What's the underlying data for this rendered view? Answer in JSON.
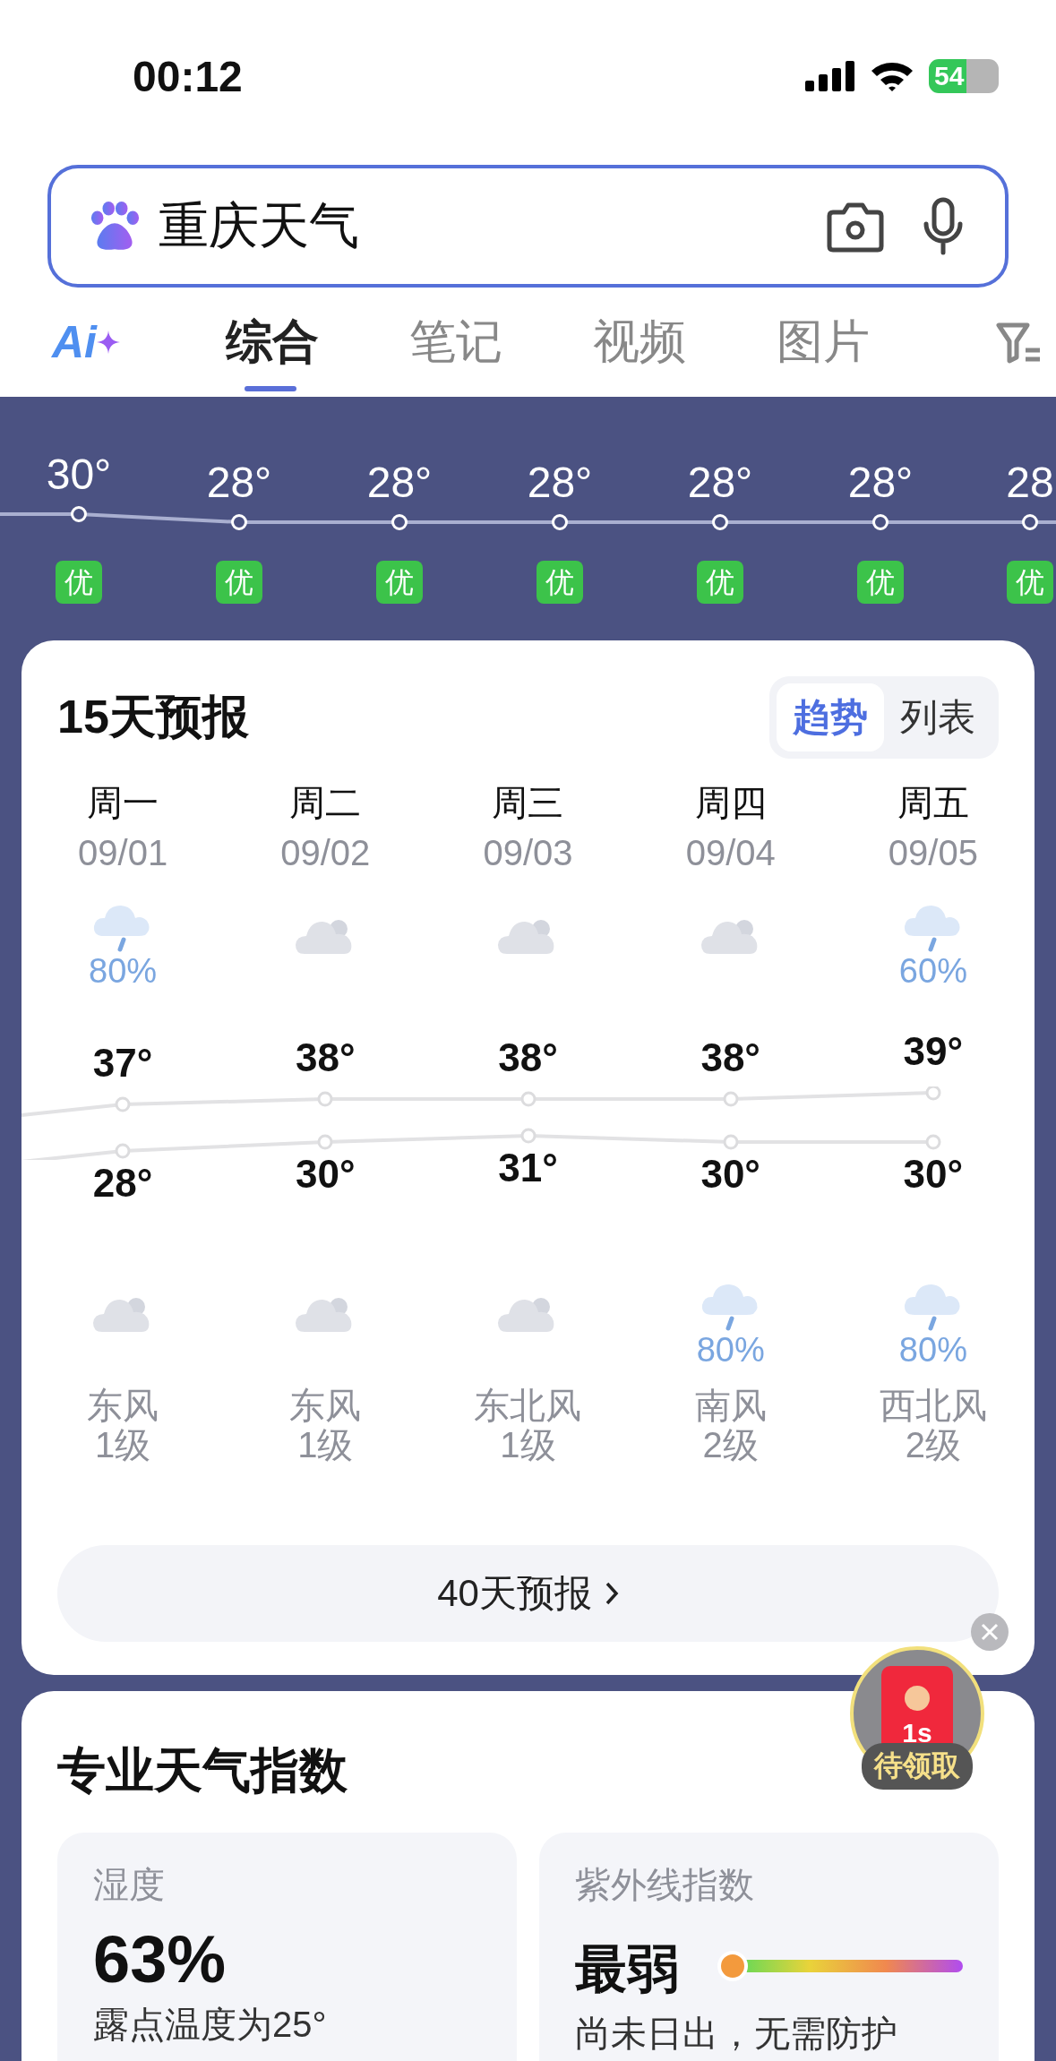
{
  "status_bar": {
    "time": "00:12",
    "battery": "54"
  },
  "search": {
    "value": "重庆天气"
  },
  "ai_label": "Ai",
  "tabs": [
    {
      "label": "综合",
      "selected": true
    },
    {
      "label": "笔记",
      "selected": false
    },
    {
      "label": "视频",
      "selected": false
    },
    {
      "label": "图片",
      "selected": false
    }
  ],
  "hourly": [
    {
      "temp": "30°",
      "aqi": "优",
      "color": "#3cc34a"
    },
    {
      "temp": "28°",
      "aqi": "优",
      "color": "#3cc34a"
    },
    {
      "temp": "28°",
      "aqi": "优",
      "color": "#3cc34a"
    },
    {
      "temp": "28°",
      "aqi": "优",
      "color": "#3cc34a"
    },
    {
      "temp": "28°",
      "aqi": "优",
      "color": "#3cc34a"
    },
    {
      "temp": "28°",
      "aqi": "优",
      "color": "#3cc34a"
    },
    {
      "temp": "28",
      "aqi": "优",
      "color": "#3cc34a"
    }
  ],
  "forecast": {
    "title": "15天预报",
    "views": [
      {
        "label": "趋势",
        "selected": true
      },
      {
        "label": "列表",
        "selected": false
      }
    ],
    "days": [
      {
        "weekday": "周一",
        "date": "09/01",
        "day": {
          "kind": "rain",
          "precip": "80%"
        },
        "high": "37°",
        "low": "28°",
        "night": {
          "kind": "cloudy"
        },
        "wind": "东风",
        "wind_level": "1级"
      },
      {
        "weekday": "周二",
        "date": "09/02",
        "day": {
          "kind": "cloudy"
        },
        "high": "38°",
        "low": "30°",
        "night": {
          "kind": "cloudy"
        },
        "wind": "东风",
        "wind_level": "1级"
      },
      {
        "weekday": "周三",
        "date": "09/03",
        "day": {
          "kind": "cloudy"
        },
        "high": "38°",
        "low": "31°",
        "night": {
          "kind": "cloudy"
        },
        "wind": "东北风",
        "wind_level": "1级"
      },
      {
        "weekday": "周四",
        "date": "09/04",
        "day": {
          "kind": "cloudy"
        },
        "high": "38°",
        "low": "30°",
        "night": {
          "kind": "rain",
          "precip": "80%"
        },
        "wind": "南风",
        "wind_level": "2级"
      },
      {
        "weekday": "周五",
        "date": "09/05",
        "day": {
          "kind": "rain",
          "precip": "60%"
        },
        "high": "39°",
        "low": "30°",
        "night": {
          "kind": "rain",
          "precip": "80%"
        },
        "wind": "西北风",
        "wind_level": "2级"
      }
    ],
    "more_button": "40天预报"
  },
  "reward": {
    "countdown": "1s",
    "label": "待领取"
  },
  "indices": {
    "title": "专业天气指数",
    "cards": [
      {
        "kind": "value",
        "label": "湿度",
        "value": "63%",
        "note": "露点温度为25°"
      },
      {
        "kind": "scale",
        "label": "紫外线指数",
        "value": "最弱",
        "level": 0,
        "note": "尚未日出，无需防护"
      }
    ]
  }
}
